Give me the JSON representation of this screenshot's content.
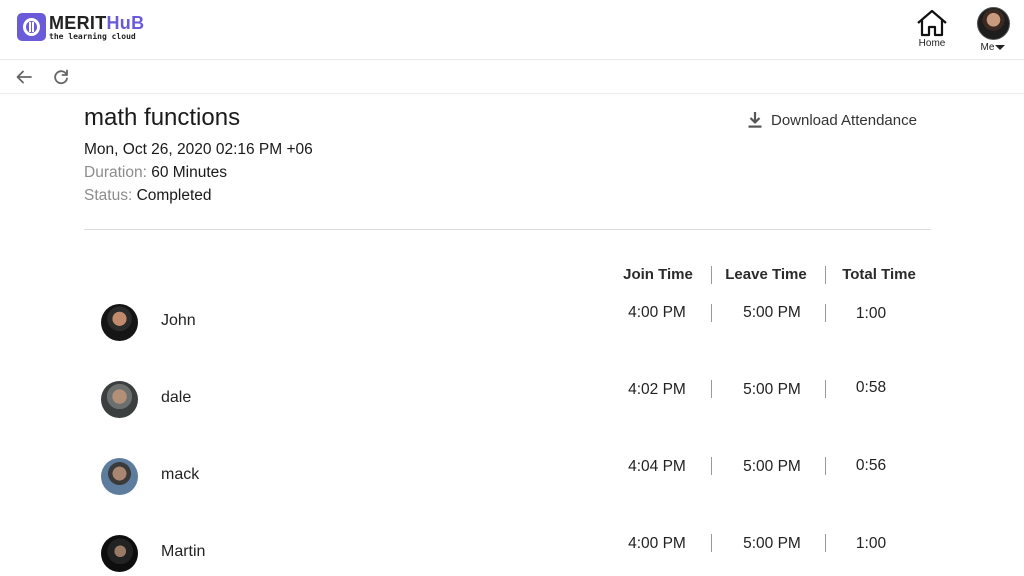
{
  "header": {
    "logo_merit": "MERIT",
    "logo_hub": "HuB",
    "logo_tagline": "the learning cloud",
    "home_label": "Home",
    "me_label": "Me"
  },
  "colors": {
    "brand": "#6a5bd8"
  },
  "toolbar": {
    "back_icon": "arrow-left-icon",
    "refresh_icon": "refresh-icon"
  },
  "class_info": {
    "title": "math functions",
    "datetime": "Mon, Oct 26, 2020 02:16 PM +06",
    "duration_label": "Duration:",
    "duration_value": "60 Minutes",
    "status_label": "Status:",
    "status_value": "Completed"
  },
  "download": {
    "label": "Download Attendance",
    "icon": "download-icon"
  },
  "table": {
    "columns": [
      "Join Time",
      "Leave Time",
      "Total Time"
    ],
    "rows": [
      {
        "name": "John",
        "join": "4:00 PM",
        "leave": "5:00 PM",
        "total": "1:00"
      },
      {
        "name": "dale",
        "join": "4:02 PM",
        "leave": "5:00 PM",
        "total": "0:58"
      },
      {
        "name": "mack",
        "join": "4:04 PM",
        "leave": "5:00 PM",
        "total": "0:56"
      },
      {
        "name": "Martin",
        "join": "4:00 PM",
        "leave": "5:00 PM",
        "total": "1:00"
      }
    ]
  }
}
